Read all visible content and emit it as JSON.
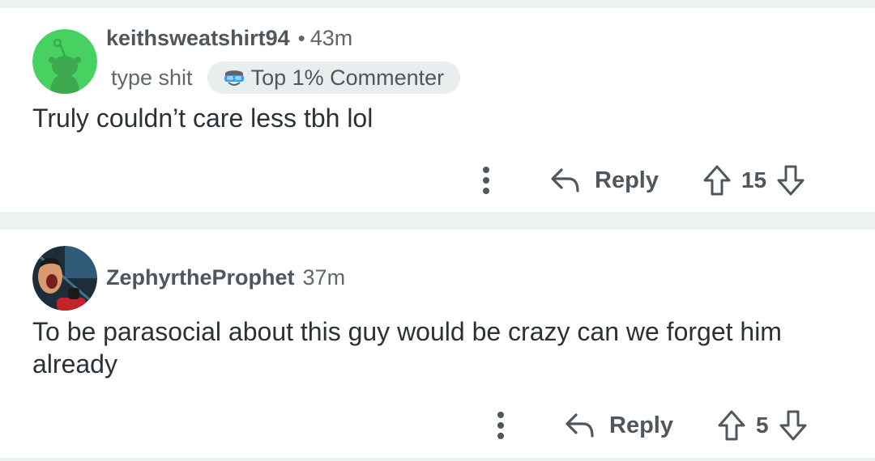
{
  "colors": {
    "page_background": "#eef1f2",
    "card_background": "#ffffff",
    "text_primary": "#2a3236",
    "text_secondary": "#5d676c",
    "badge_background": "#e8eded",
    "avatar_green": "#46d160"
  },
  "comments": [
    {
      "username": "keithsweatshirt94",
      "separator": "•",
      "time": "43m",
      "user_flair": "type shit",
      "badge": {
        "icon": "top-commenter-icon",
        "label": "Top 1% Commenter"
      },
      "avatar_icon": "snoo-avatar-icon",
      "body": "Truly couldn’t care less tbh lol",
      "actions": {
        "more_icon": "more-vertical-icon",
        "reply_icon": "reply-arrow-icon",
        "reply_label": "Reply",
        "upvote_icon": "upvote-arrow-icon",
        "score": "15",
        "downvote_icon": "downvote-arrow-icon"
      }
    },
    {
      "username": "ZephyrtheProphet",
      "time": "37m",
      "avatar_icon": "cartoon-avatar-icon",
      "body": "To be parasocial about this guy would be crazy can we forget him already",
      "actions": {
        "more_icon": "more-vertical-icon",
        "reply_icon": "reply-arrow-icon",
        "reply_label": "Reply",
        "upvote_icon": "upvote-arrow-icon",
        "score": "5",
        "downvote_icon": "downvote-arrow-icon"
      }
    }
  ]
}
